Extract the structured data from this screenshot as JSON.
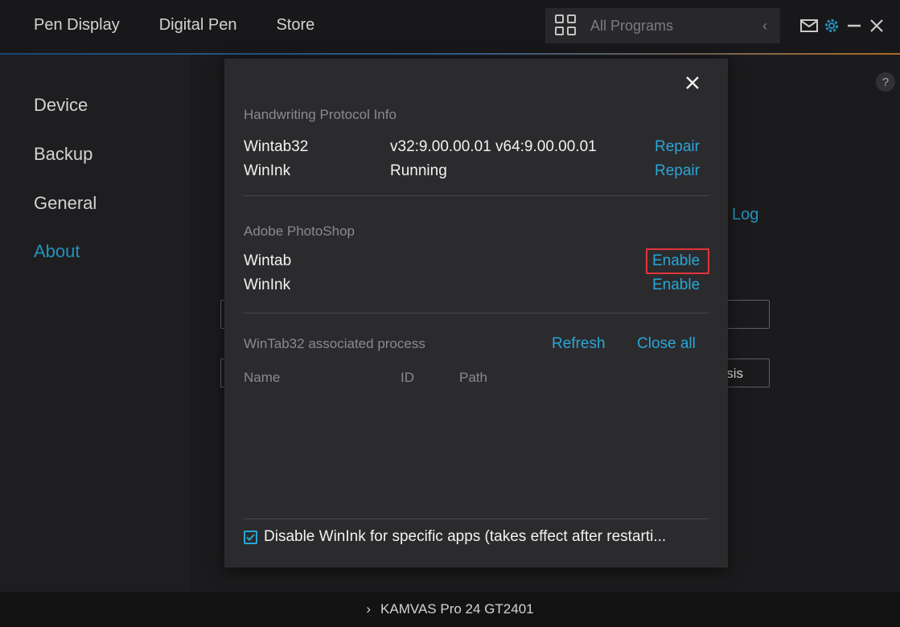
{
  "topbar": {
    "nav": [
      "Pen Display",
      "Digital Pen",
      "Store"
    ],
    "program_select": "All Programs"
  },
  "sidebar": {
    "items": [
      {
        "label": "Device",
        "active": false
      },
      {
        "label": "Backup",
        "active": false
      },
      {
        "label": "General",
        "active": false
      },
      {
        "label": "About",
        "active": true
      }
    ]
  },
  "background": {
    "log_link": "Log",
    "box2_text": "sis"
  },
  "bottombar": {
    "device": "KAMVAS Pro 24 GT2401"
  },
  "modal": {
    "handwriting": {
      "title": "Handwriting Protocol Info",
      "rows": [
        {
          "name": "Wintab32",
          "value": "v32:9.00.00.01  v64:9.00.00.01",
          "action": "Repair"
        },
        {
          "name": "WinInk",
          "value": "Running",
          "action": "Repair"
        }
      ]
    },
    "photoshop": {
      "title": "Adobe PhotoShop",
      "rows": [
        {
          "name": "Wintab",
          "action": "Enable"
        },
        {
          "name": "WinInk",
          "action": "Enable"
        }
      ]
    },
    "process": {
      "title": "WinTab32 associated process",
      "refresh": "Refresh",
      "close_all": "Close all",
      "columns": [
        "Name",
        "ID",
        "Path"
      ]
    },
    "disable_wink": {
      "label": "Disable WinInk for specific apps (takes effect after restarti...",
      "checked": true
    }
  },
  "colors": {
    "accent": "#2aa6d8",
    "highlight": "#e0343a"
  }
}
